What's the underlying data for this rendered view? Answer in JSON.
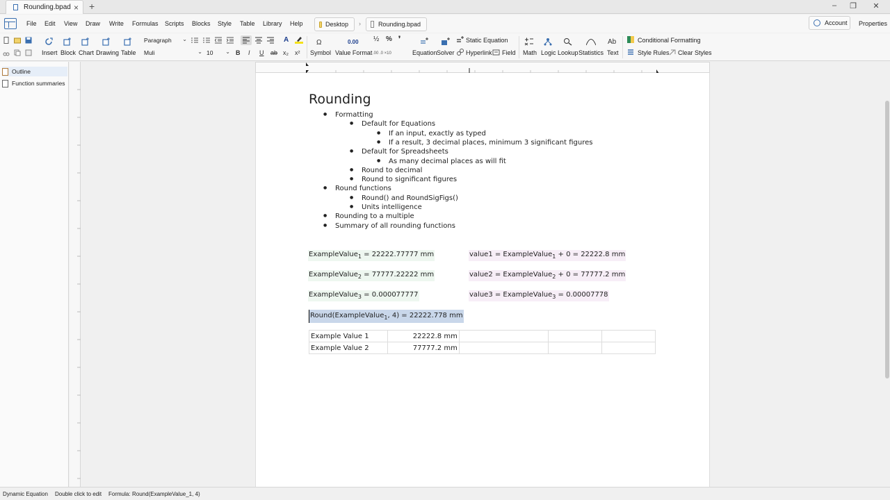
{
  "window": {
    "tab_title": "Rounding.bpad",
    "new_tab": "+",
    "minimize": "–",
    "restore": "❐",
    "close": "✕",
    "tab_close": "×"
  },
  "menu": {
    "items": [
      "File",
      "Edit",
      "View",
      "Draw",
      "Write",
      "Formulas",
      "Scripts",
      "Blocks",
      "Style",
      "Table",
      "Library",
      "Help"
    ],
    "breadcrumb": [
      "Desktop",
      "Rounding.bpad"
    ],
    "breadcrumb_sep": "›",
    "account": "Account",
    "properties": "Properties"
  },
  "ribbon": {
    "insert": "Insert",
    "block": "Block",
    "chart": "Chart",
    "drawing": "Drawing",
    "table": "Table",
    "paragraph_style": "Paragraph",
    "font": "Muli",
    "font_size": "10",
    "symbol": "Symbol",
    "symbol_glyph": "Ω",
    "value_format": "Value Format",
    "value_format_glyph": "0.00",
    "equation": "Equation",
    "solver": "Solver",
    "static_equation": "Static Equation",
    "hyperlink": "Hyperlink",
    "field": "Field",
    "math": "Math",
    "logic": "Logic",
    "lookup": "Lookup",
    "statistics": "Statistics",
    "text": "Text",
    "text_glyph": "Ab",
    "conditional_formatting": "Conditional Formatting",
    "style_rules": "Style Rules",
    "clear_styles": "Clear Styles",
    "bold": "B",
    "italic": "I",
    "underline": "U",
    "strike": "ab",
    "subscript": "x₂",
    "superscript": "x²",
    "font_color": "A",
    "fraction": "½",
    "percent": "%",
    "comma": "❜"
  },
  "sidebar": {
    "items": [
      {
        "label": "Outline"
      },
      {
        "label": "Function summaries"
      }
    ]
  },
  "document": {
    "title": "Rounding",
    "outline": [
      {
        "text": "Formatting",
        "level": 1
      },
      {
        "text": "Default for Equations",
        "level": 2
      },
      {
        "text": "If an input, exactly as typed",
        "level": 3
      },
      {
        "text": "If a result, 3 decimal places, minimum 3 significant figures",
        "level": 3
      },
      {
        "text": "Default for Spreadsheets",
        "level": 2
      },
      {
        "text": "As many decimal places as will fit",
        "level": 3
      },
      {
        "text": "Round to decimal",
        "level": 2
      },
      {
        "text": "Round to significant figures",
        "level": 2
      },
      {
        "text": "Round functions",
        "level": 1
      },
      {
        "text": "Round() and RoundSigFigs()",
        "level": 2
      },
      {
        "text": "Units intelligence",
        "level": 2
      },
      {
        "text": "Rounding to a multiple",
        "level": 1
      },
      {
        "text": "Summary of all rounding functions",
        "level": 1
      }
    ],
    "equations_left": [
      {
        "name": "ExampleValue",
        "sub": "1",
        "rest": " = 22222.77777 mm"
      },
      {
        "name": "ExampleValue",
        "sub": "2",
        "rest": " = 77777.22222 mm"
      },
      {
        "name": "ExampleValue",
        "sub": "3",
        "rest": " = 0.000077777"
      }
    ],
    "equations_right": [
      {
        "pre": "value1 = ExampleValue",
        "sub": "1",
        "rest": " + 0 = 22222.8 mm"
      },
      {
        "pre": "value2 = ExampleValue",
        "sub": "2",
        "rest": " + 0 = 77777.2 mm"
      },
      {
        "pre": "value3 = ExampleValue",
        "sub": "3",
        "rest": " = 0.00007778"
      }
    ],
    "round_equation": {
      "pre": "Round(ExampleValue",
      "sub": "1",
      "rest": ", 4) = 22222.778 mm"
    },
    "table": [
      [
        "Example Value 1",
        "22222.8 mm",
        "",
        "",
        ""
      ],
      [
        "Example Value 2",
        "77777.2 mm",
        "",
        "",
        ""
      ]
    ]
  },
  "status": {
    "type": "Dynamic Equation",
    "hint": "Double click to edit",
    "formula_label": "Formula:",
    "formula": "Round(ExampleValue_1, 4)"
  }
}
